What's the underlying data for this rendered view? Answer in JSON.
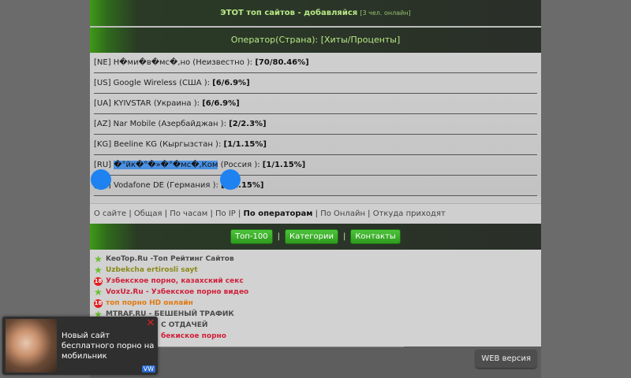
{
  "header": {
    "title": "ЭТОТ топ сайтов - добавляйся",
    "online": "[3 чел. онлайн]",
    "subtitle": "Оператор(Страна): [Хиты/Проценты]"
  },
  "rows": [
    {
      "prefix": "[NE] Н�ми�в�мс�,но (Неизвестно ): ",
      "value": "[70/80.46%]"
    },
    {
      "prefix": "[US] Google Wireless (США ): ",
      "value": "[6/6.9%]"
    },
    {
      "prefix": "[UA] KYIVSTAR (Украина ): ",
      "value": "[6/6.9%]"
    },
    {
      "prefix": "[AZ] Nar Mobile (Азербайджан ): ",
      "value": "[2/2.3%]"
    },
    {
      "prefix": "[KG] Beeline KG (Кыргызстан ): ",
      "value": "[1/1.15%]"
    },
    {
      "prefix": "[RU] ",
      "highlight": "�°йк�°�»�°�мс�,Ком",
      "suffix": " (Россия ): ",
      "value": "[1/1.15%]"
    },
    {
      "prefix": "[DE] Vodafone DE (Германия ): ",
      "value": "[1/1.15%]"
    }
  ],
  "nav": {
    "items": [
      "О сайте",
      "Общая",
      "По часам",
      "По IP",
      "По операторам",
      "По Онлайн",
      "Откуда приходят"
    ],
    "active": "По операторам"
  },
  "buttons": [
    "Топ-100",
    "Категории",
    "Контакты"
  ],
  "links": [
    {
      "text": "KeoTop.Ru -Топ Рейтинг Сайтов",
      "color": "#4a4a4a",
      "icon": "star-icon"
    },
    {
      "text": "Uzbekcha ertirosli sayt",
      "color": "#8a8a1a",
      "icon": "star-icon"
    },
    {
      "text": "Узбекское порно, казахский секс",
      "color": "#d0203a",
      "icon": "18-icon"
    },
    {
      "text": "VoxUz.Ru - Узбекское порно видео",
      "color": "#d0203a",
      "icon": "star-icon"
    },
    {
      "text": "топ порно HD онлайн",
      "color": "#e07a10",
      "icon": "18-icon"
    },
    {
      "text": "MTRAF.RU - БЕШЕНЫЙ ТРАФИК",
      "color": "#4a4a4a",
      "icon": "star-icon"
    },
    {
      "text": "С ОТДАЧЕЙ",
      "color": "#4a4a4a",
      "icon": "none"
    },
    {
      "text": "бекиское порно",
      "color": "#d0203a",
      "icon": "none"
    }
  ],
  "footer": {
    "web_label": "WEB версия"
  },
  "ad": {
    "text": "Новый сайт бесплатного порно на мобильник",
    "close": "✕",
    "badge": "VW"
  }
}
